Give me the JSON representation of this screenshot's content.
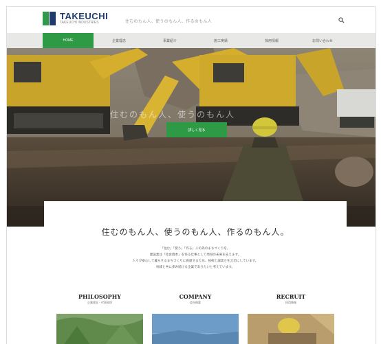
{
  "header": {
    "brand": "TAKEUCHI",
    "brand_sub": "TAKEUCHI INDUSTRIES",
    "tagline": "住むのもん人、使うのもん人、作るのもん人"
  },
  "nav": {
    "items": [
      {
        "label": "HOME"
      },
      {
        "label": "企業理念"
      },
      {
        "label": "事業紹介"
      },
      {
        "label": "施工実績"
      },
      {
        "label": "採用情報"
      },
      {
        "label": "お問い合わせ"
      }
    ],
    "active_index": 0
  },
  "hero": {
    "copy": "住むのもん人、使うのもん人",
    "button_label": "詳しく見る"
  },
  "intro": {
    "catch": "住むのもん人、使うのもん人、作るのもん人。",
    "lines": [
      "「住む」「使う」「作る」人の為のまちづくりを。",
      "建設業は「社会資本」を作る仕事として地域の未来を支えます。",
      "人々が安心して暮らせるまちづくりに貢献するため、技術と誠実さを大切にしています。",
      "地域と共に歩み続ける企業でありたいと考えています。"
    ]
  },
  "cards": [
    {
      "title": "PHILOSOPHY",
      "sub": "企業理念・代表挨拶"
    },
    {
      "title": "COMPANY",
      "sub": "会社概要"
    },
    {
      "title": "RECRUIT",
      "sub": "採用情報"
    }
  ],
  "colors": {
    "accent": "#2e9a46",
    "brand_navy": "#1e3b6e",
    "nav_bg": "#e8e8e6"
  }
}
